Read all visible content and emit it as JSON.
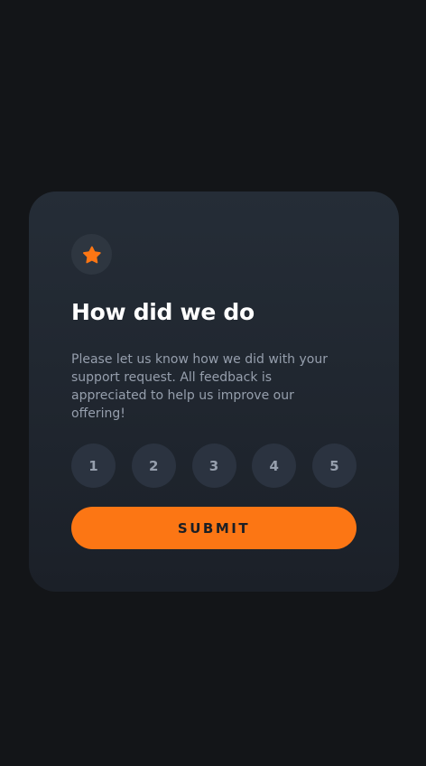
{
  "card": {
    "title": "How did we do",
    "description": "Please let us know how we did with your support request. All feedback is appreciated to help us improve our offering!",
    "star_icon": "star-icon"
  },
  "ratings": [
    "1",
    "2",
    "3",
    "4",
    "5"
  ],
  "submit_label": "SUBMIT",
  "colors": {
    "page_background": "#131518",
    "card_background_top": "#252d37",
    "card_background_bottom": "#1b2028",
    "accent": "#fc7614",
    "rating_background": "#2b3340",
    "muted_text": "#969fad",
    "title_text": "#ffffff"
  }
}
